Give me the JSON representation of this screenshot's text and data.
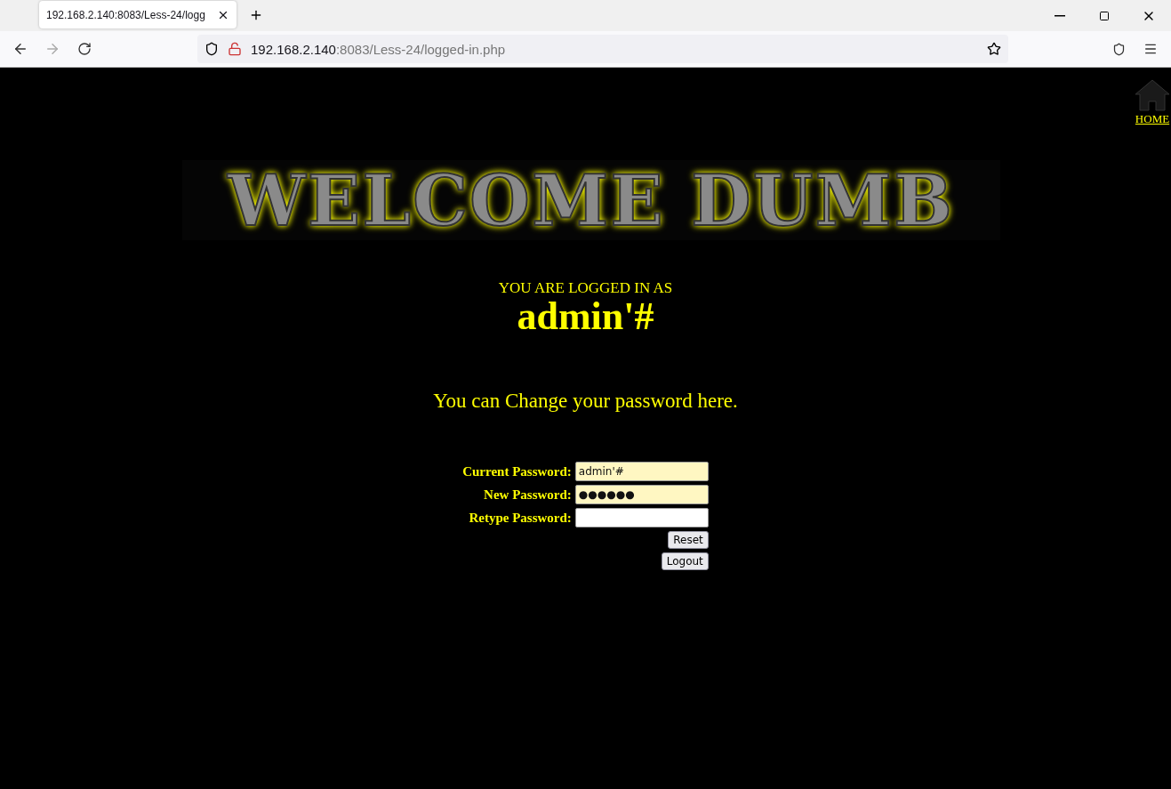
{
  "browser": {
    "tab": {
      "title": "192.168.2.140:8083/Less-24/logg",
      "selected": true
    },
    "address": {
      "host": "192.168.2.140",
      "rest": ":8083/Less-24/logged-in.php"
    }
  },
  "page": {
    "home_link": "HOME",
    "banner": "WELCOME DUMB",
    "logged_in_label": "YOU ARE LOGGED IN AS",
    "username": "admin'#",
    "prompt": "You can Change your password here.",
    "fields": [
      {
        "label": "Current Password:",
        "value": "admin'#",
        "autofilled": true
      },
      {
        "label": "New Password:",
        "value": "●●●●●●",
        "autofilled": true
      },
      {
        "label": "Retype Password:",
        "autofilled": false
      }
    ],
    "buttons": [
      "Reset",
      "Logout"
    ]
  }
}
